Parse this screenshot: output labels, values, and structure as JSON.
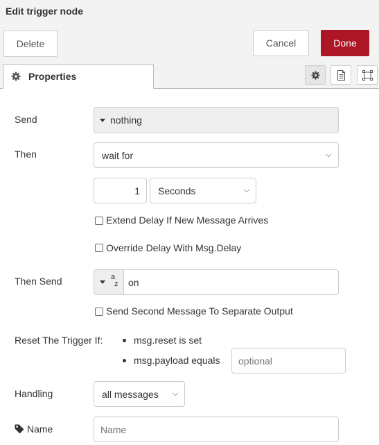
{
  "dialog": {
    "title": "Edit trigger node",
    "delete_label": "Delete",
    "cancel_label": "Cancel",
    "done_label": "Done"
  },
  "tabs": {
    "properties_label": "Properties"
  },
  "icons": {
    "settings": "gear-icon",
    "description": "document-icon",
    "appearance": "frame-icon",
    "tag": "tag-icon",
    "caret": "caret-down-icon",
    "chevron": "chevron-down-icon",
    "string_type": "az-icon"
  },
  "form": {
    "send": {
      "label": "Send",
      "value": "nothing"
    },
    "then": {
      "label": "Then",
      "value": "wait for"
    },
    "delay": {
      "value": "1",
      "unit": "Seconds"
    },
    "extend_delay_label": "Extend Delay If New Message Arrives",
    "override_delay_label": "Override Delay With Msg.Delay",
    "then_send": {
      "label": "Then Send",
      "type_sup": "a",
      "type_sub": "z",
      "value": "on"
    },
    "second_output_label": "Send Second Message To Separate Output",
    "reset": {
      "label": "Reset The Trigger If:",
      "item1": "msg.reset is set",
      "item2": "msg.payload equals",
      "placeholder": "optional"
    },
    "handling": {
      "label": "Handling",
      "value": "all messages"
    },
    "name": {
      "label": "Name",
      "placeholder": "Name"
    }
  },
  "colors": {
    "primary": "#ad1625",
    "header_bg": "#f3f3f3",
    "border": "#cccccc"
  }
}
